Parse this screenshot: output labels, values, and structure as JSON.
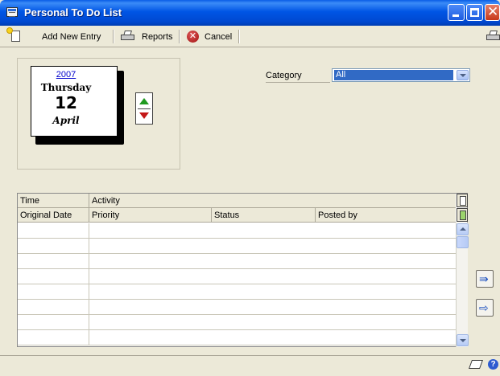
{
  "window": {
    "title": "Personal To Do List"
  },
  "toolbar": {
    "add_new_entry": "Add New Entry",
    "reports": "Reports",
    "cancel": "Cancel"
  },
  "calendar": {
    "year": "2007",
    "weekday": "Thursday",
    "day": "12",
    "month": "April"
  },
  "category": {
    "label": "Category",
    "selected": "All"
  },
  "grid": {
    "header_row1": [
      "Time",
      "Activity"
    ],
    "header_row2": [
      "Original Date",
      "Priority",
      "Status",
      "Posted by"
    ],
    "row_count": 8
  },
  "colors": {
    "titlebar": "#0055e5",
    "selection": "#316ac5",
    "window_bg": "#ece9d8"
  },
  "icons": {
    "app": "list-icon",
    "new": "new-entry-icon",
    "print": "printer-icon",
    "cancel": "cancel-icon",
    "up": "arrow-up-icon",
    "down": "arrow-down-icon",
    "side1": "expand-right-icon",
    "side2": "arrow-right-icon",
    "note": "note-icon",
    "help": "help-icon"
  }
}
